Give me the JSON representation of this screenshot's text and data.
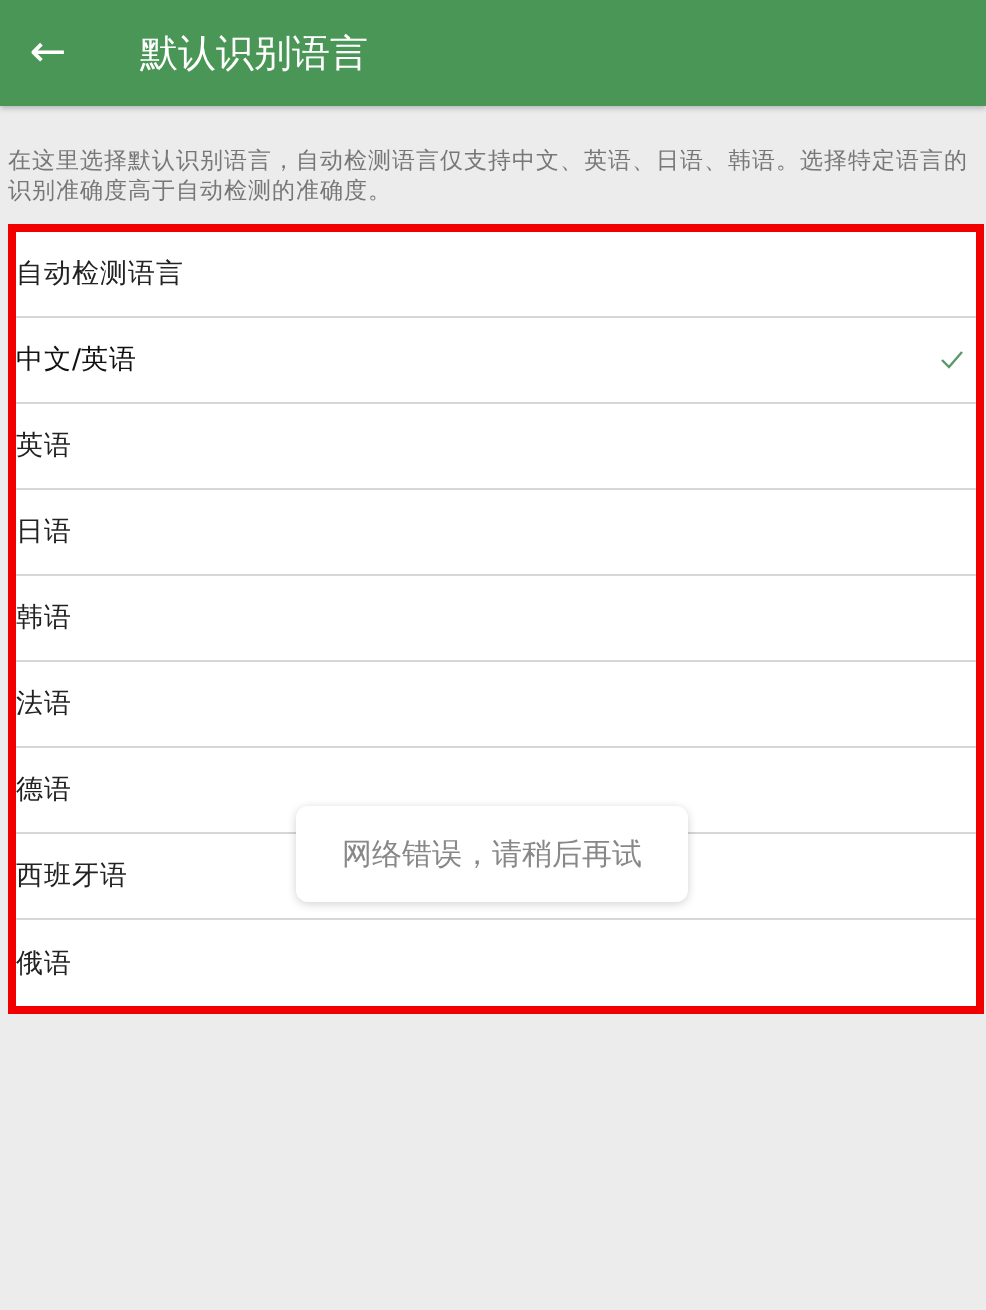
{
  "app_bar": {
    "back": "←",
    "title": "默认识别语言"
  },
  "description": "在这里选择默认识别语言，自动检测语言仅支持中文、英语、日语、韩语。选择特定语言的识别准确度高于自动检测的准确度。",
  "highlight": true,
  "languages": [
    {
      "label": "自动检测语言",
      "selected": false
    },
    {
      "label": "中文/英语",
      "selected": true
    },
    {
      "label": "英语",
      "selected": false
    },
    {
      "label": "日语",
      "selected": false
    },
    {
      "label": "韩语",
      "selected": false
    },
    {
      "label": "法语",
      "selected": false
    },
    {
      "label": "德语",
      "selected": false
    },
    {
      "label": "西班牙语",
      "selected": false
    },
    {
      "label": "俄语",
      "selected": false
    }
  ],
  "toast": "网络错误，请稍后再试"
}
